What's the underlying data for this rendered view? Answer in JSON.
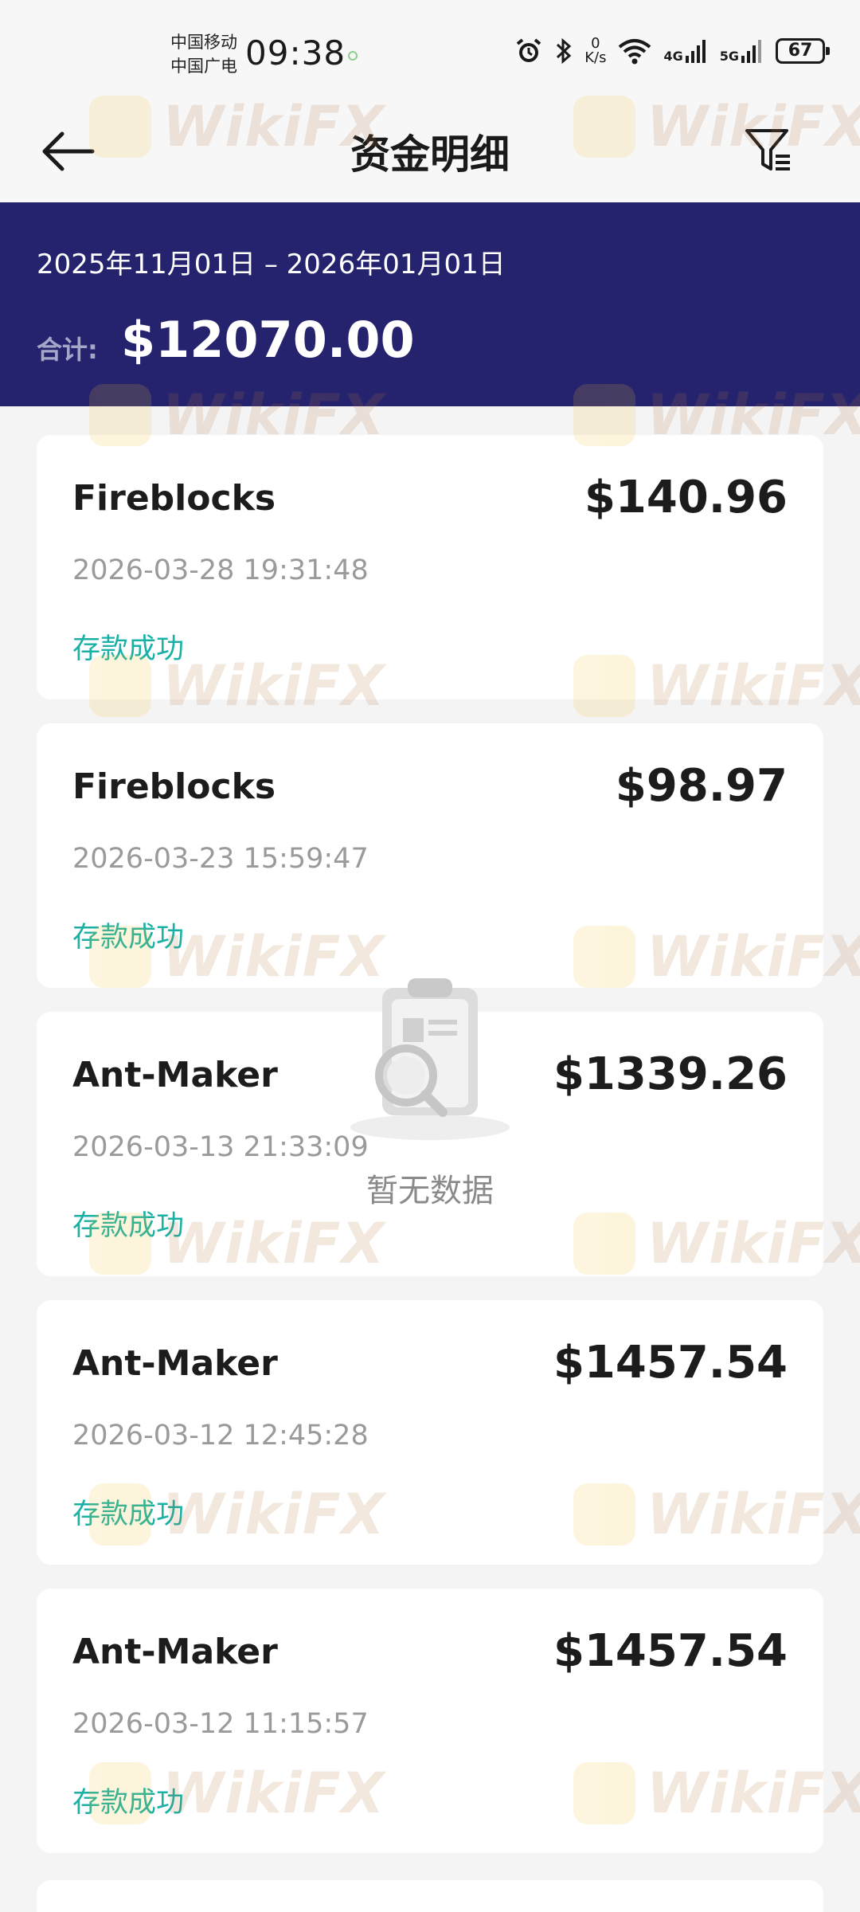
{
  "status_bar": {
    "carrier_1": "中国移动",
    "carrier_2": "中国广电",
    "time": "09:38",
    "net_speed_value": "0",
    "net_speed_unit": "K/s",
    "signal_1": "4G",
    "signal_2": "5G",
    "battery": "67",
    "icons": [
      "alarm-icon",
      "bluetooth-icon",
      "wifi-icon",
      "signal-icon",
      "battery-icon"
    ]
  },
  "header": {
    "title": "资金明细",
    "back_icon": "arrow-left-icon",
    "filter_icon": "filter-icon"
  },
  "summary": {
    "date_range": "2025年11月01日 – 2026年01月01日",
    "total_label": "合计:",
    "total_value": "$12070.00",
    "background_color": "#25236e"
  },
  "transactions": [
    {
      "merchant": "Fireblocks",
      "amount": "$140.96",
      "datetime": "2026-03-28 19:31:48",
      "status": "存款成功"
    },
    {
      "merchant": "Fireblocks",
      "amount": "$98.97",
      "datetime": "2026-03-23 15:59:47",
      "status": "存款成功"
    },
    {
      "merchant": "Ant-Maker",
      "amount": "$1339.26",
      "datetime": "2026-03-13 21:33:09",
      "status": "存款成功"
    },
    {
      "merchant": "Ant-Maker",
      "amount": "$1457.54",
      "datetime": "2026-03-12 12:45:28",
      "status": "存款成功"
    },
    {
      "merchant": "Ant-Maker",
      "amount": "$1457.54",
      "datetime": "2026-03-12 11:15:57",
      "status": "存款成功"
    }
  ],
  "empty_state": {
    "text": "暂无数据",
    "icon": "clipboard-search-icon"
  },
  "watermark": {
    "text": "WikiFX"
  },
  "colors": {
    "accent_status": "#19b0a6",
    "page_background": "#f4f4f5"
  }
}
